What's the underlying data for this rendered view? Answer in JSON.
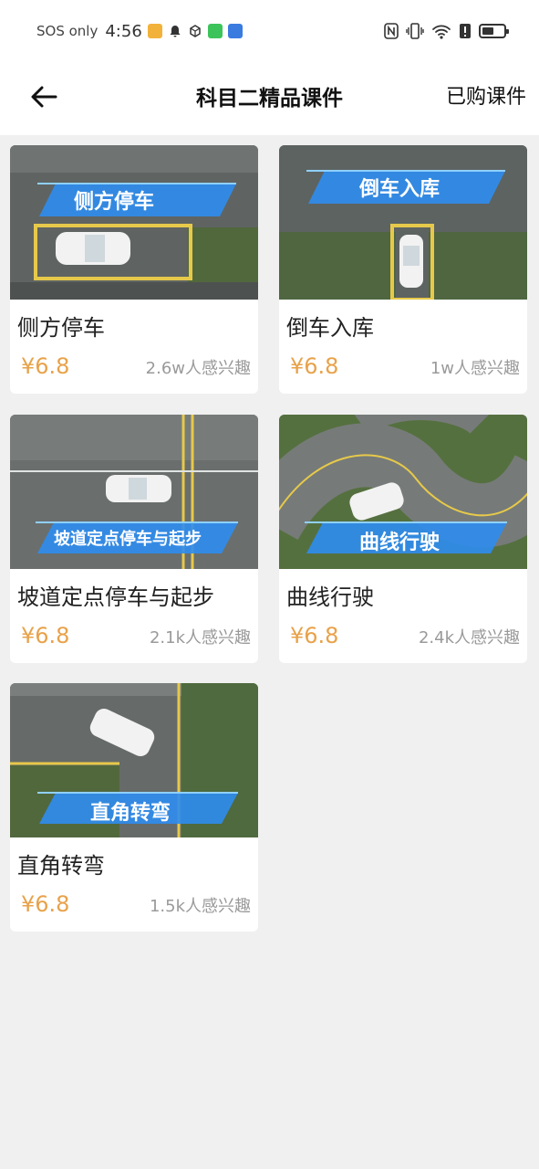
{
  "status_bar": {
    "carrier": "SOS only",
    "time": "4:56"
  },
  "header": {
    "title": "科目二精品课件",
    "purchased_label": "已购课件"
  },
  "courses": [
    {
      "title": "侧方停车",
      "banner": "侧方停车",
      "price": "¥6.8",
      "interest": "2.6w人感兴趣"
    },
    {
      "title": "倒车入库",
      "banner": "倒车入库",
      "price": "¥6.8",
      "interest": "1w人感兴趣"
    },
    {
      "title": "坡道定点停车与起步",
      "banner": "坡道定点停车与起步",
      "price": "¥6.8",
      "interest": "2.1k人感兴趣"
    },
    {
      "title": "曲线行驶",
      "banner": "曲线行驶",
      "price": "¥6.8",
      "interest": "2.4k人感兴趣"
    },
    {
      "title": "直角转弯",
      "banner": "直角转弯",
      "price": "¥6.8",
      "interest": "1.5k人感兴趣"
    }
  ],
  "colors": {
    "price": "#e8a24a",
    "banner_blue": "#2f8df0",
    "background": "#f0f0f0"
  }
}
